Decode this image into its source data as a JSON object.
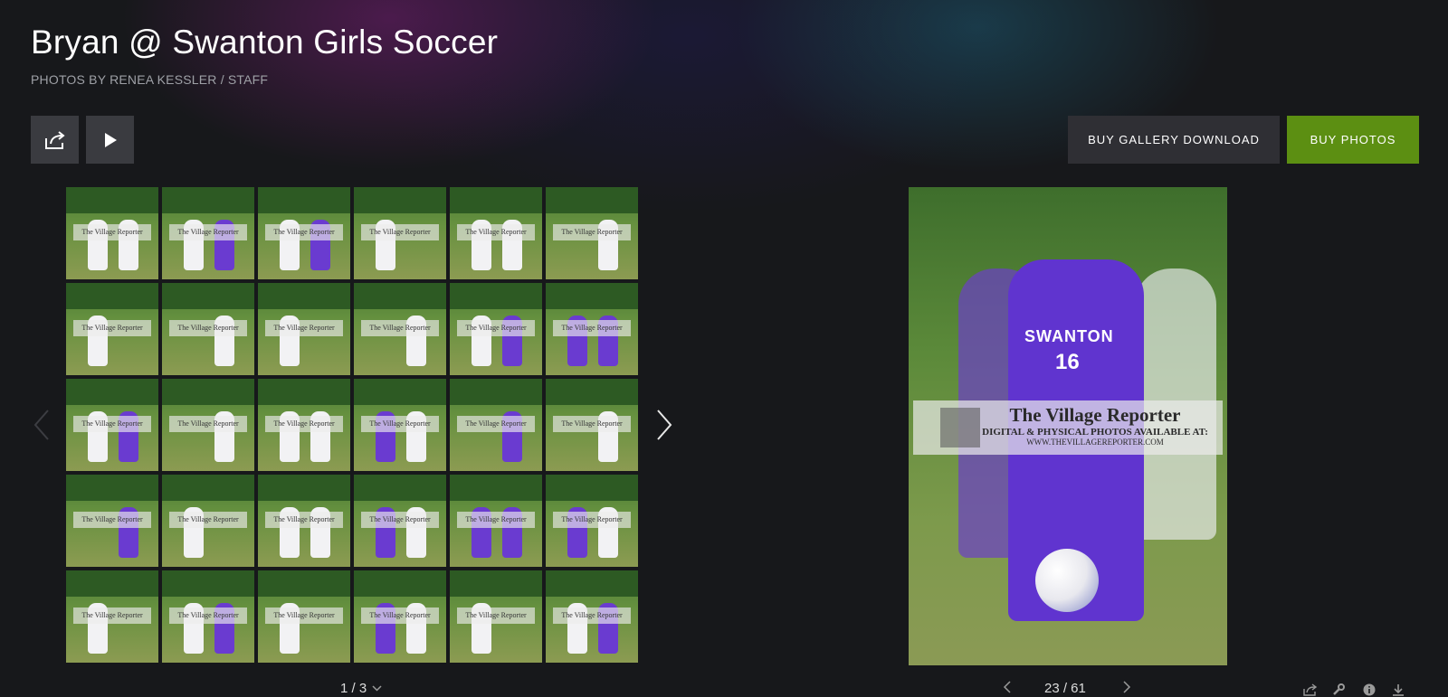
{
  "gallery": {
    "title": "Bryan @ Swanton Girls Soccer",
    "credit": "PHOTOS BY RENEA KESSLER / STAFF"
  },
  "toolbar": {
    "share_icon": "share-icon",
    "play_icon": "play-icon",
    "buy_gallery_download": "BUY GALLERY DOWNLOAD",
    "buy_photos": "BUY PHOTOS"
  },
  "colors": {
    "buy_photos_bg": "#5c8f12",
    "button_dark": "#2f2f34",
    "icon_button": "#3a3b40"
  },
  "thumbnails": {
    "watermark": "The Village Reporter",
    "pager": "1 / 3",
    "pager_icon": "chevron-down-icon",
    "prev_icon": "chevron-left-icon",
    "next_icon": "chevron-right-icon"
  },
  "photo": {
    "watermark_title": "The Village Reporter",
    "watermark_line2": "DIGITAL & PHYSICAL PHOTOS AVAILABLE AT:",
    "watermark_line3": "WWW.THEVILLAGEREPORTER.COM",
    "jersey_text": "SWANTON",
    "jersey_number": "16",
    "counter": "23 / 61"
  },
  "photo_tools": [
    "share-icon",
    "wrench-icon",
    "info-icon",
    "download-icon"
  ]
}
